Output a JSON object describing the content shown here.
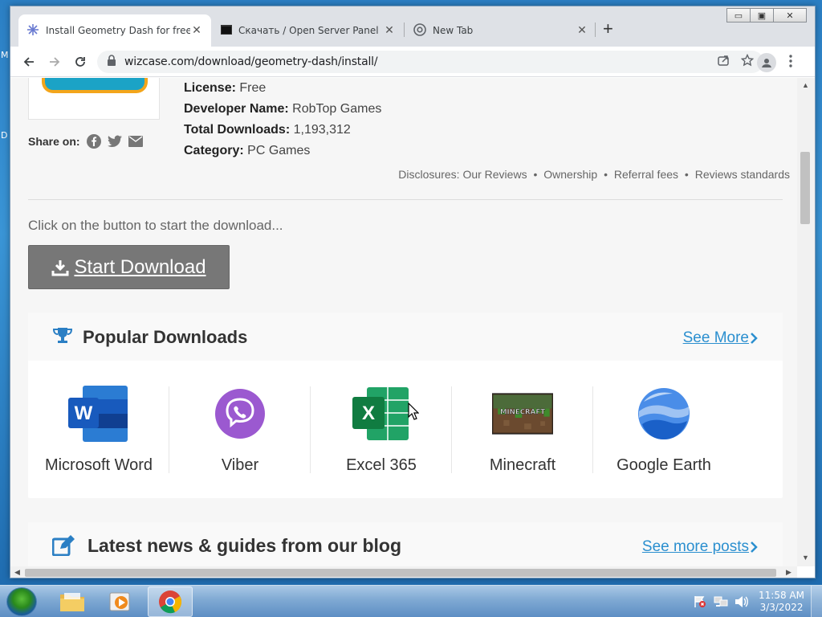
{
  "desktop": {
    "left_letters": [
      "M",
      "D"
    ]
  },
  "browser": {
    "tabs": [
      {
        "title": "Install Geometry Dash for free an",
        "icon": "wizcase-favicon",
        "active": true
      },
      {
        "title": "Скачать / Open Server Panel",
        "icon": "terminal-favicon",
        "active": false
      },
      {
        "title": "New Tab",
        "icon": "chrome-favicon",
        "active": false
      }
    ],
    "tab_close": "✕",
    "new_tab": "+",
    "window_buttons": {
      "minimize": "▭",
      "maximize": "▣",
      "close": "✕"
    },
    "url": "wizcase.com/download/geometry-dash/install/"
  },
  "page": {
    "license_label": "License:",
    "license_value": "Free",
    "developer_label": "Developer Name:",
    "developer_value": "RobTop Games",
    "downloads_label": "Total Downloads:",
    "downloads_value": "1,193,312",
    "category_label": "Category:",
    "category_value": "PC Games",
    "share_label": "Share on:",
    "disclosures": {
      "label": "Disclosures:",
      "links": [
        "Our Reviews",
        "Ownership",
        "Referral fees",
        "Reviews standards"
      ]
    },
    "click_text": "Click on the button to start the download...",
    "start_button": "Start Download",
    "popular": {
      "title": "Popular Downloads",
      "see_more": "See More",
      "apps": [
        "Microsoft Word",
        "Viber",
        "Excel 365",
        "Minecraft",
        "Google Earth"
      ],
      "minecraft_logo_text": "MINECRAFT"
    },
    "blog": {
      "title": "Latest news & guides from our blog",
      "see_more": "See more posts"
    }
  },
  "taskbar": {
    "time": "11:58 AM",
    "date": "3/3/2022"
  },
  "colors": {
    "link": "#2b8fcf",
    "button_gray": "#777777",
    "taskbar": "#7fa9d3"
  }
}
